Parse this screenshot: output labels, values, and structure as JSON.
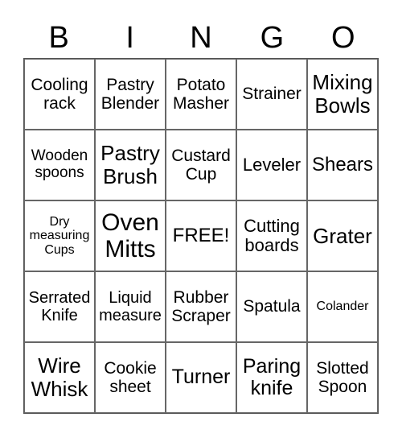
{
  "header": {
    "letters": [
      "B",
      "I",
      "N",
      "G",
      "O"
    ]
  },
  "card": {
    "rows": [
      [
        "Cooling\nrack",
        "Pastry\nBlender",
        "Potato\nMasher",
        "Strainer",
        "Mixing\nBowls"
      ],
      [
        "Wooden\nspoons",
        "Pastry\nBrush",
        "Custard\nCup",
        "Leveler",
        "Shears"
      ],
      [
        "Dry\nmeasuring\nCups",
        "Oven\nMitts",
        "FREE!",
        "Cutting\nboards",
        "Grater"
      ],
      [
        "Serrated\nKnife",
        "Liquid\nmeasure",
        "Rubber\nScraper",
        "Spatula",
        "Colander"
      ],
      [
        "Wire\nWhisk",
        "Cookie\nsheet",
        "Turner",
        "Paring\nknife",
        "Slotted\nSpoon"
      ]
    ]
  }
}
